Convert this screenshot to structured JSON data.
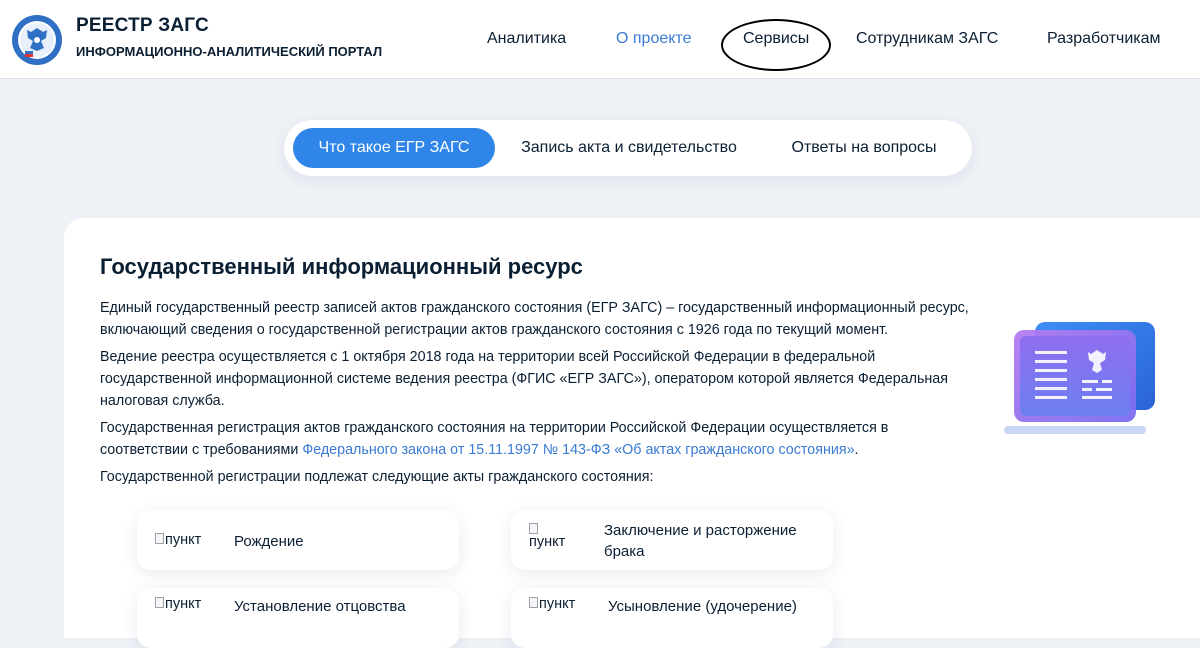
{
  "header": {
    "title": "РЕЕСТР ЗАГС",
    "subtitle": "ИНФОРМАЦИОННО-АНАЛИТИЧЕСКИЙ ПОРТАЛ",
    "nav": [
      "Аналитика",
      "О проекте",
      "Сервисы",
      "Сотрудникам ЗАГС",
      "Разработчикам"
    ],
    "active_nav": "О проекте",
    "circled_nav": "Сервисы"
  },
  "tabs": [
    "Что такое ЕГР ЗАГС",
    "Запись акта и свидетельство",
    "Ответы на вопросы"
  ],
  "active_tab": "Что такое ЕГР ЗАГС",
  "content": {
    "heading": "Государственный информационный ресурс",
    "p1": "Единый государственный реестр записей актов гражданского состояния (ЕГР ЗАГС) – государственный информационный ресурс, включающий сведения о государственной регистрации актов гражданского состояния с 1926 года по текущий момент.",
    "p2": "Ведение реестра осуществляется с 1 октября 2018 года на территории всей Российской Федерации в федеральной государственной информационной системе ведения реестра (ФГИС «ЕГР ЗАГС»), оператором которой является Федеральная налоговая служба.",
    "p3_text": "Государственная регистрация актов гражданского состояния на территории Российской Федерации осуществляется в соответствии с требованиями ",
    "p3_link": "Федерального закона от 15.11.1997 № 143-ФЗ «Об актах гражданского состояния»",
    "p3_end": ".",
    "p4": "Государственной регистрации подлежат следующие акты гражданского состояния:"
  },
  "items": [
    {
      "img_alt": "пункт",
      "label": "Рождение"
    },
    {
      "img_alt": "пункт",
      "label": "Заключение и расторжение брака"
    },
    {
      "img_alt": "пункт",
      "label": "Установление отцовства"
    },
    {
      "img_alt": "пункт",
      "label": "Усыновление (удочерение)"
    }
  ],
  "colors": {
    "accent": "#2f86e8",
    "link": "#3a7bd5",
    "background": "#eef1f6",
    "text": "#0b1f33"
  }
}
